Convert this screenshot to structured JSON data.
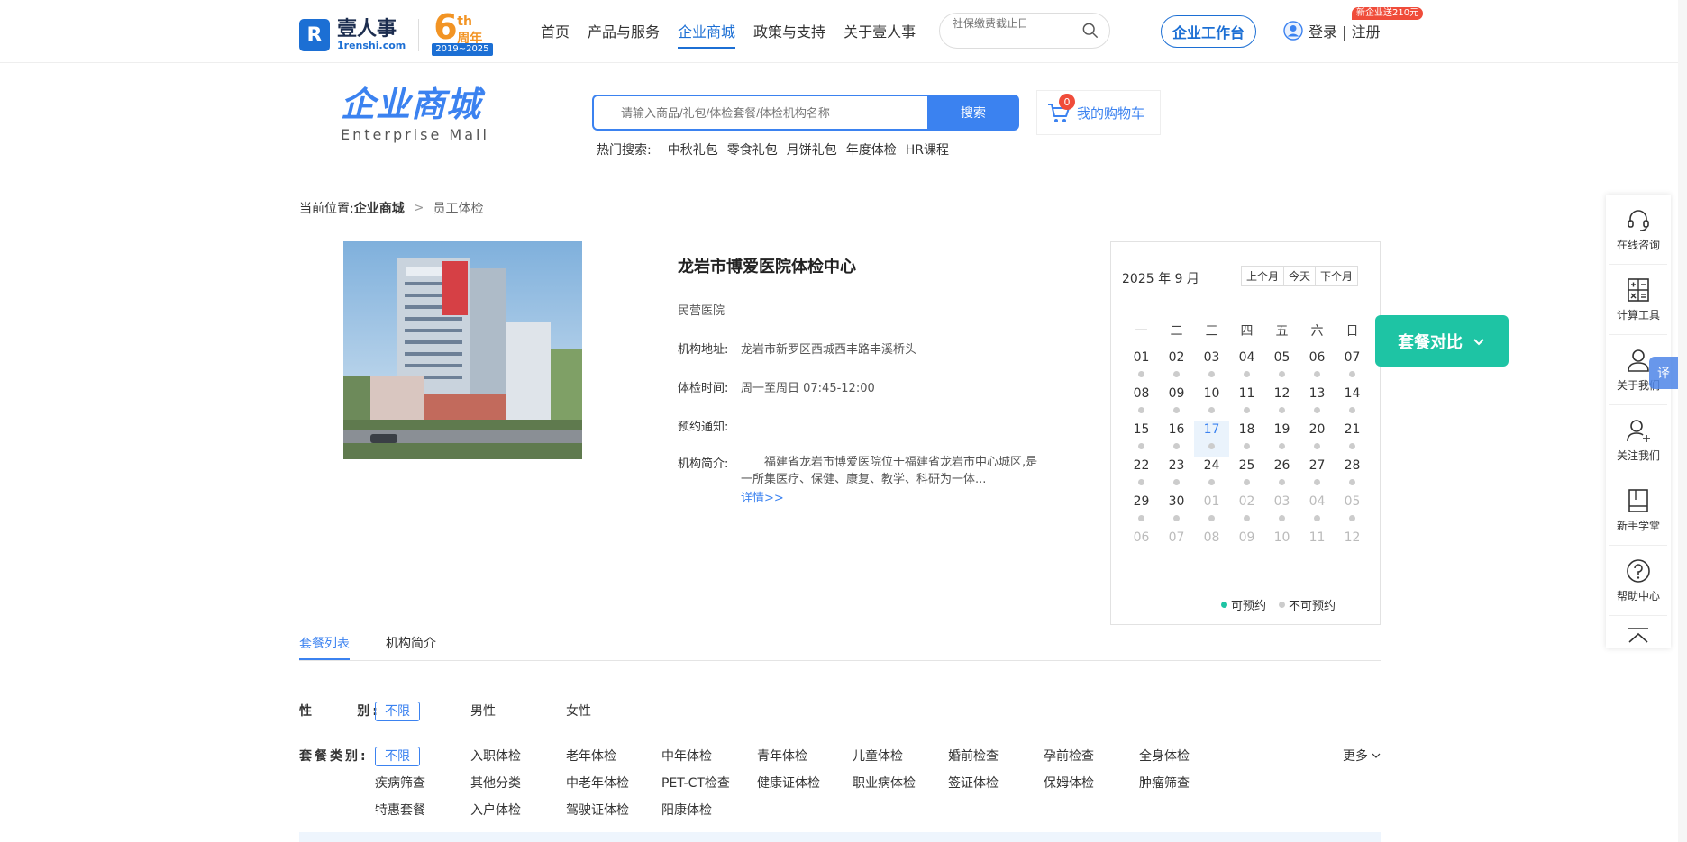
{
  "header": {
    "logo_cn": "壹人事",
    "logo_en": "1renshi.com",
    "anniversary_num": "6",
    "anniversary_th": "th",
    "anniversary_cn": "周年",
    "anniversary_years": "2019~2025",
    "nav": [
      {
        "label": "首页"
      },
      {
        "label": "产品与服务"
      },
      {
        "label": "企业商城",
        "active": true
      },
      {
        "label": "政策与支持"
      },
      {
        "label": "关于壹人事"
      }
    ],
    "search_placeholder": "社保缴费截止日",
    "workbench_label": "企业工作台",
    "login_label": "登录 | 注册",
    "promo_badge": "新企业送210元"
  },
  "mall": {
    "title_cn": "企业商城",
    "title_en": "Enterprise  Mall",
    "search_placeholder": "请输入商品/礼包/体检套餐/体检机构名称",
    "search_button": "搜索",
    "hot_label": "热门搜索:",
    "hot_terms": [
      "中秋礼包",
      "零食礼包",
      "月饼礼包",
      "年度体检",
      "HR课程"
    ],
    "cart_label": "我的购物车",
    "cart_count": "0"
  },
  "breadcrumb": {
    "prefix": "当前位置:",
    "current": "企业商城",
    "sep": ">",
    "last": "员工体检"
  },
  "institution": {
    "name": "龙岩市博爱医院体检中心",
    "type": "民营医院",
    "address_label": "机构地址:",
    "address": "龙岩市新罗区西城西丰路丰溪桥头",
    "hours_label": "体检时间:",
    "hours": "周一至周日 07:45-12:00",
    "notice_label": "预约通知:",
    "notice": "",
    "intro_label": "机构简介:",
    "intro": "福建省龙岩市博爱医院位于福建省龙岩市中心城区,是一所集医疗、保健、康复、教学、科研为一体...",
    "detail_link": "详情>>"
  },
  "calendar": {
    "title": "2025 年 9 月",
    "prev_label": "上个月",
    "today_label": "今天",
    "next_label": "下个月",
    "weekdays": [
      "一",
      "二",
      "三",
      "四",
      "五",
      "六",
      "日"
    ],
    "weeks": [
      [
        "01",
        "02",
        "03",
        "04",
        "05",
        "06",
        "07"
      ],
      [
        "08",
        "09",
        "10",
        "11",
        "12",
        "13",
        "14"
      ],
      [
        "15",
        "16",
        "17",
        "18",
        "19",
        "20",
        "21"
      ],
      [
        "22",
        "23",
        "24",
        "25",
        "26",
        "27",
        "28"
      ],
      [
        "29",
        "30",
        "01",
        "02",
        "03",
        "04",
        "05"
      ],
      [
        "06",
        "07",
        "08",
        "09",
        "10",
        "11",
        "12"
      ]
    ],
    "today": "17",
    "legend_available": "可预约",
    "legend_unavailable": "不可预约",
    "available_color": "#1ec4a4",
    "unavailable_color": "#cccccc"
  },
  "compare_button": "套餐对比",
  "tabs": [
    {
      "label": "套餐列表",
      "active": true
    },
    {
      "label": "机构简介"
    }
  ],
  "filters": {
    "gender_label": "性      别:",
    "gender_options": [
      "不限",
      "男性",
      "女性"
    ],
    "category_label": "套餐类别:",
    "category_options": [
      "不限",
      "入职体检",
      "老年体检",
      "中年体检",
      "青年体检",
      "儿童体检",
      "婚前检查",
      "孕前检查",
      "全身体检",
      "疾病筛查",
      "其他分类",
      "中老年体检",
      "PET-CT检查",
      "健康证体检",
      "职业病体检",
      "签证体检",
      "保姆体检",
      "肿瘤筛查",
      "特惠套餐",
      "入户体检",
      "驾驶证体检",
      "阳康体检"
    ],
    "more_label": "更多"
  },
  "sidebar": [
    {
      "label": "在线咨询",
      "icon": "headset-icon"
    },
    {
      "label": "计算工具",
      "icon": "calculator-icon"
    },
    {
      "label": "关于我们",
      "icon": "person-icon"
    },
    {
      "label": "关注我们",
      "icon": "person-add-icon"
    },
    {
      "label": "新手学堂",
      "icon": "book-icon"
    },
    {
      "label": "帮助中心",
      "icon": "help-icon"
    }
  ],
  "translate_label": "译"
}
